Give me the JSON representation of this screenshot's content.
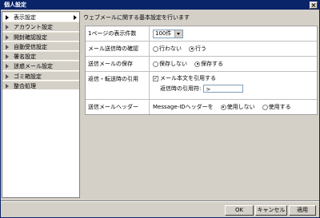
{
  "window": {
    "title": "個人設定",
    "close_label": "×"
  },
  "sidebar": {
    "items": [
      {
        "label": "表示設定"
      },
      {
        "label": "アカウント設定"
      },
      {
        "label": "開封確認設定"
      },
      {
        "label": "自動受信設定"
      },
      {
        "label": "署名設定"
      },
      {
        "label": "迷惑メール設定"
      },
      {
        "label": "ゴミ箱設定"
      },
      {
        "label": "整合処理"
      }
    ]
  },
  "main": {
    "heading": "ウェブメールに関する基本設定を行います",
    "rows": {
      "per_page": {
        "label": "1ページの表示件数",
        "value": "100件"
      },
      "send_confirm": {
        "label": "メール送信時の確認",
        "opt1": "行わない",
        "opt2": "行う"
      },
      "save_sent": {
        "label": "送信メールの保存",
        "opt1": "保存しない",
        "opt2": "保存する"
      },
      "quote": {
        "label": "返信・転送時の引用",
        "check_label": "メール本文を引用する",
        "quote_char_label": "返信時の引用符:",
        "quote_char_value": ">"
      },
      "header": {
        "label": "送信メールヘッダー",
        "desc": "Message-IDヘッダーを",
        "opt1": "使用しない",
        "opt2": "使用する"
      }
    }
  },
  "buttons": {
    "ok": "OK",
    "cancel": "キャンセル",
    "apply": "適用"
  }
}
